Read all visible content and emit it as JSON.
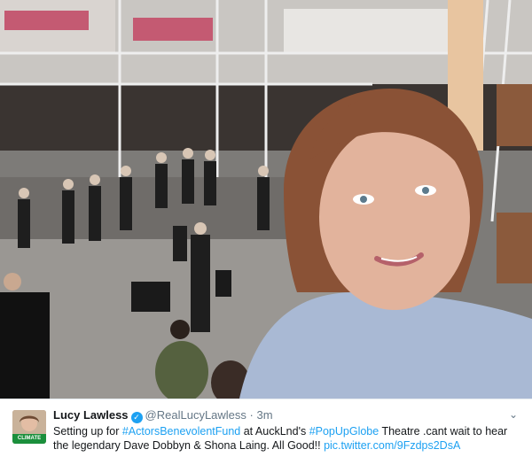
{
  "tweet": {
    "display_name": "Lucy Lawless",
    "handle": "@RealLucyLawless",
    "separator": "·",
    "time": "3m",
    "avatar_badge": "CLIMATE VOTER",
    "text_parts": {
      "t1": "Setting up for ",
      "hashtag1": "#ActorsBenevolentFund",
      "t2": " at AuckLnd's ",
      "hashtag2": "#PopUpGlobe",
      "t3": " Theatre .cant wait to hear the legendary Dave Dobbyn & Shona Laing. All Good!! ",
      "link": "pic.twitter.com/9Fzdps2DsA"
    }
  },
  "icons": {
    "verified": "verified-check-icon",
    "caret": "chevron-down-icon"
  },
  "colors": {
    "link": "#1da1f2",
    "verified": "#1da1f2",
    "text": "#14171a",
    "muted": "#657786"
  }
}
